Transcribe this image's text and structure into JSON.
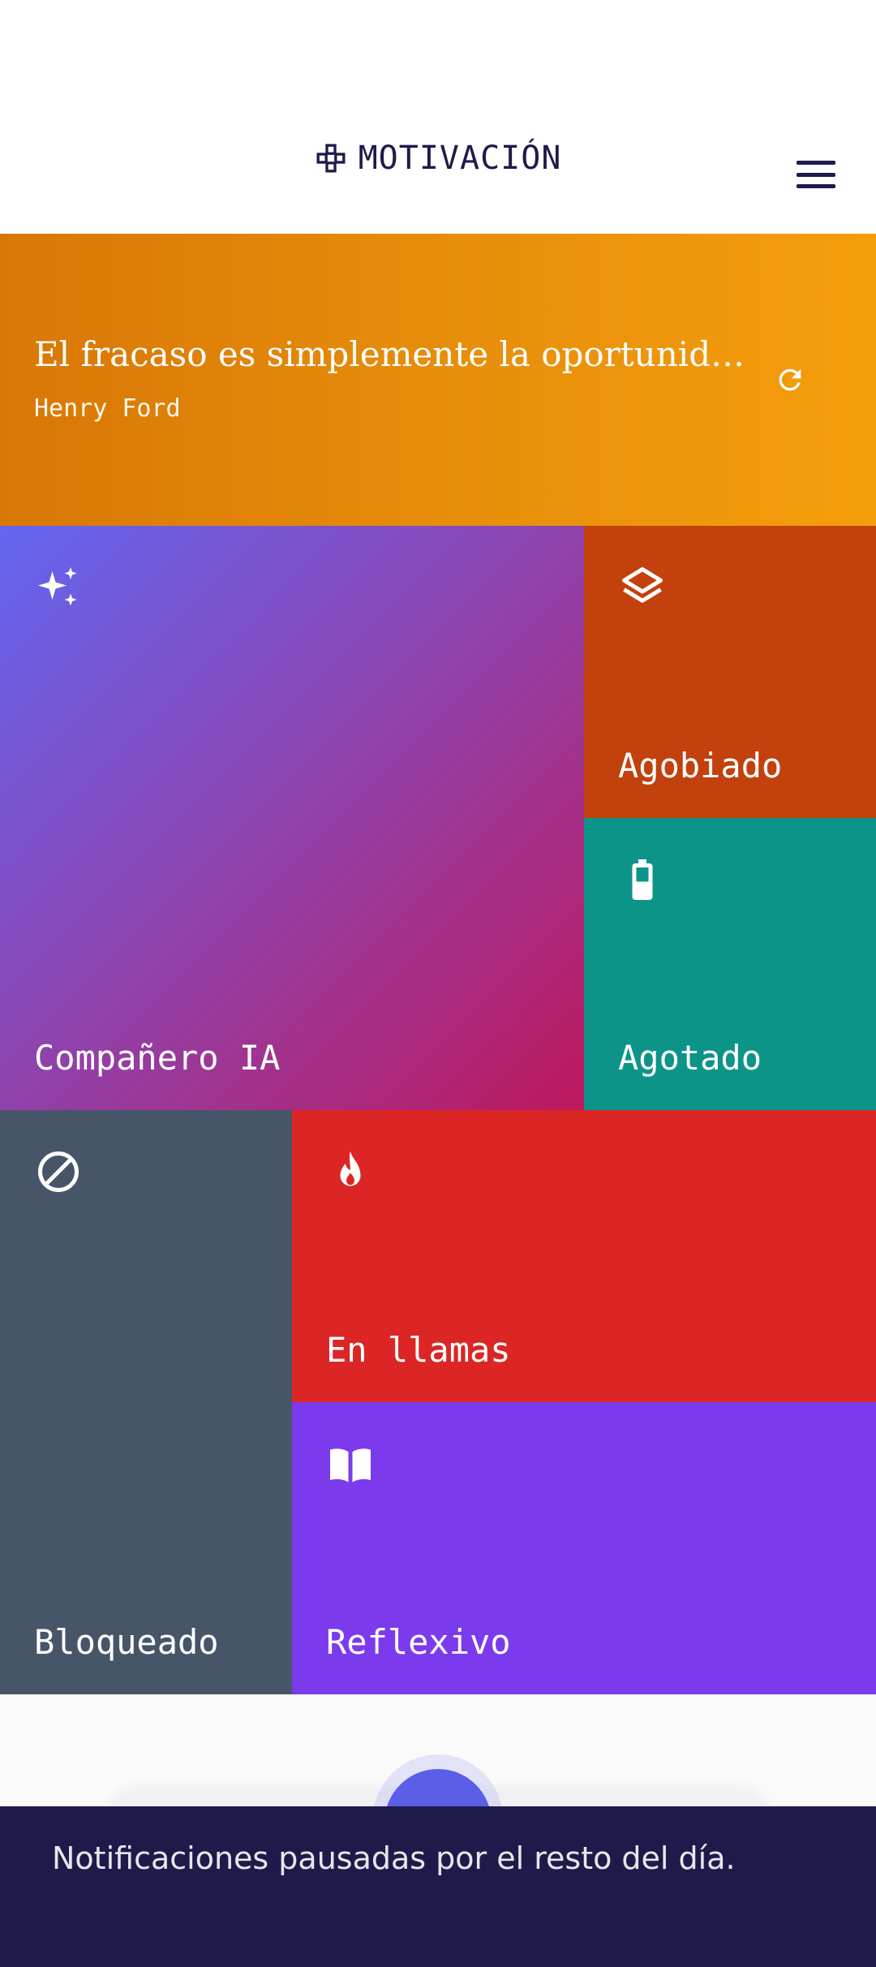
{
  "header": {
    "title": "MOTIVACIÓN",
    "brand_icon": "gamepad-icon",
    "menu_icon": "hamburger-menu-icon"
  },
  "quote": {
    "text": "El fracaso es simplemente la oportunidad de comenzar de nuevo, esta vez de forma más inteligente.",
    "author": "Henry Ford",
    "refresh_icon": "refresh-icon"
  },
  "tiles": [
    {
      "label": "Compañero IA",
      "icon": "sparkles-icon",
      "color": "#6366f1"
    },
    {
      "label": "Agobiado",
      "icon": "layers-icon",
      "color": "#c2410c"
    },
    {
      "label": "Agotado",
      "icon": "battery-icon",
      "color": "#0d9488"
    },
    {
      "label": "Bloqueado",
      "icon": "prohibited-icon",
      "color": "#475569"
    },
    {
      "label": "En llamas",
      "icon": "fire-icon",
      "color": "#dc2626"
    },
    {
      "label": "Reflexivo",
      "icon": "book-open-icon",
      "color": "#7c3aed"
    }
  ],
  "snackbar": {
    "message": "Notificaciones pausadas por el resto del día."
  },
  "colors": {
    "quote_banner": "#e88f0b",
    "snackbar_bg": "#1e1b4b",
    "fab": "#5b5ee6"
  }
}
